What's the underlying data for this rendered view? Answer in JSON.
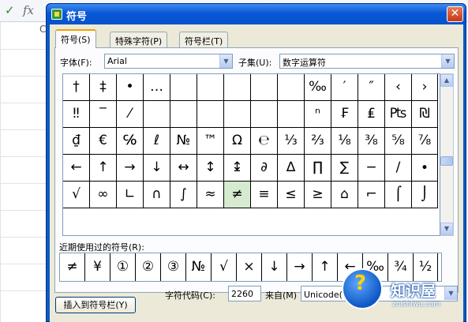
{
  "spreadsheet": {
    "check_glyph": "✓",
    "fx_label": "fx",
    "col_letter": "C"
  },
  "dialog": {
    "title": "符号",
    "close_glyph": "✕",
    "tabs": [
      {
        "label": "符号(S)",
        "active": true
      },
      {
        "label": "特殊字符(P)",
        "active": false
      },
      {
        "label": "符号栏(T)",
        "active": false
      }
    ],
    "font_label": "字体(F):",
    "font_value": "Arial",
    "subset_label": "子集(U):",
    "subset_value": "数字运算符",
    "symbols": [
      [
        "†",
        "‡",
        "•",
        "…",
        "",
        "",
        "",
        "",
        "",
        "‰",
        "′",
        "″",
        "‹",
        "›"
      ],
      [
        "‼",
        "‾",
        "⁄",
        "",
        "",
        "",
        "",
        "",
        "",
        "ⁿ",
        "₣",
        "₤",
        "₧",
        "₪"
      ],
      [
        "₫",
        "€",
        "℅",
        "ℓ",
        "№",
        "™",
        "Ω",
        "℮",
        "⅓",
        "⅔",
        "⅛",
        "⅜",
        "⅝",
        "⅞"
      ],
      [
        "←",
        "↑",
        "→",
        "↓",
        "↔",
        "↕",
        "↨",
        "∂",
        "∆",
        "∏",
        "∑",
        "−",
        "∕",
        "∙"
      ],
      [
        "√",
        "∞",
        "∟",
        "∩",
        "∫",
        "≈",
        "≠",
        "≡",
        "≤",
        "≥",
        "⌂",
        "⌐",
        "⌠",
        "⌡"
      ]
    ],
    "selected_symbol": "≠",
    "recent_label": "近期使用过的符号(R):",
    "recent_symbols": [
      "≠",
      "¥",
      "①",
      "②",
      "③",
      "№",
      "√",
      "×",
      "↓",
      "→",
      "↑",
      "←",
      "‰",
      "¾",
      "½"
    ],
    "code_label": "字符代码(C):",
    "code_value": "2260",
    "from_label": "来自(M)",
    "from_value": "Unicode(十六进制)",
    "insert_button": "插入到符号栏(Y)"
  },
  "watermark": {
    "text": "知识屋",
    "sub": "zhishiwu.com",
    "glyph": "?"
  }
}
